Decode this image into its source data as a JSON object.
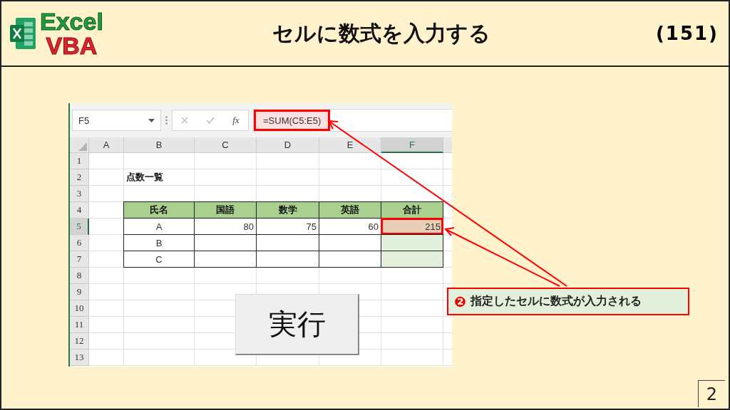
{
  "header": {
    "logo_top": "Excel",
    "logo_bottom": "VBA",
    "title": "セルに数式を入力する",
    "number": "(151)"
  },
  "excel": {
    "name_box": "F5",
    "fx_label": "fx",
    "formula": "=SUM(C5:E5)",
    "columns": [
      {
        "label": "A",
        "selected": false
      },
      {
        "label": "B",
        "selected": false
      },
      {
        "label": "C",
        "selected": false
      },
      {
        "label": "D",
        "selected": false
      },
      {
        "label": "E",
        "selected": false
      },
      {
        "label": "F",
        "selected": true
      }
    ],
    "rows": [
      {
        "number": "1",
        "selected": false
      },
      {
        "number": "2",
        "selected": false
      },
      {
        "number": "3",
        "selected": false
      },
      {
        "number": "4",
        "selected": false
      },
      {
        "number": "5",
        "selected": true
      },
      {
        "number": "6",
        "selected": false
      },
      {
        "number": "7",
        "selected": false
      },
      {
        "number": "8",
        "selected": false
      },
      {
        "number": "9",
        "selected": false
      },
      {
        "number": "10",
        "selected": false
      },
      {
        "number": "11",
        "selected": false
      },
      {
        "number": "12",
        "selected": false
      },
      {
        "number": "13",
        "selected": false
      }
    ],
    "sheet_title": "点数一覧",
    "table": {
      "headers": [
        "氏名",
        "国語",
        "数学",
        "英語",
        "合計"
      ],
      "rows": [
        {
          "cells": [
            "A",
            "80",
            "75",
            "60",
            "215"
          ]
        },
        {
          "cells": [
            "B"
          ]
        },
        {
          "cells": [
            "C"
          ]
        }
      ]
    },
    "run_button": "実行"
  },
  "callout": {
    "marker": "❷",
    "text": "指定したセルに数式が入力される"
  },
  "page_number": "2"
}
